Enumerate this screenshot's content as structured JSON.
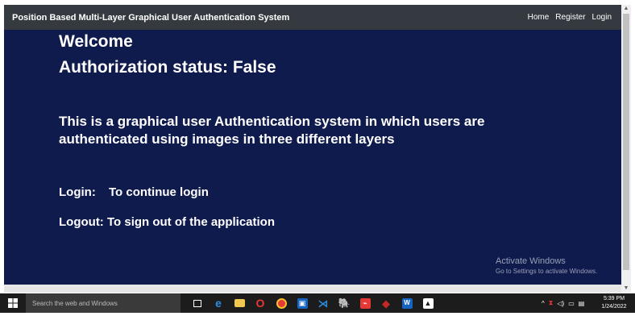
{
  "navbar": {
    "brand": "Position Based Multi-Layer Graphical User Authentication System",
    "links": [
      "Home",
      "Register",
      "Login"
    ]
  },
  "main": {
    "welcome": "Welcome",
    "auth_status": "Authorization status: False",
    "description": "This is a graphical user Authentication system in which users are authenticated using images in three different layers",
    "login_term": "Login:",
    "login_desc": "To continue login",
    "logout_line": "Logout: To sign out of the application"
  },
  "watermark": {
    "title": "Activate Windows",
    "subtitle": "Go to Settings to activate Windows."
  },
  "taskbar": {
    "search_placeholder": "Search the web and Windows",
    "apps": [
      {
        "icon": "task-view-icon",
        "color": "#1c1c1c"
      },
      {
        "icon": "edge-icon",
        "color": "#1e88e5"
      },
      {
        "icon": "file-explorer-icon",
        "color": "#f2c94c"
      },
      {
        "icon": "opera-icon",
        "color": "#e53935"
      },
      {
        "icon": "chrome-icon",
        "color": "#fbc02d"
      },
      {
        "icon": "store-icon",
        "color": "#1565c0"
      },
      {
        "icon": "vscode-icon",
        "color": "#1e88e5"
      },
      {
        "icon": "postgres-icon",
        "color": "#607d8b"
      },
      {
        "icon": "app-red-icon",
        "color": "#e53935"
      },
      {
        "icon": "app-cube-icon",
        "color": "#c62828"
      },
      {
        "icon": "word-icon",
        "color": "#1565c0"
      },
      {
        "icon": "photos-icon",
        "color": "#ffffff"
      }
    ],
    "clock_time": "5:39 PM",
    "clock_date": "1/24/2022"
  }
}
